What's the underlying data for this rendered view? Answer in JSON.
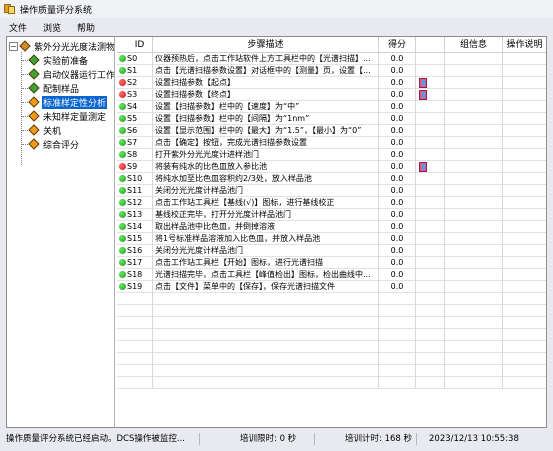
{
  "window": {
    "title": "操作质量评分系统"
  },
  "menu": [
    "文件",
    "浏览",
    "帮助"
  ],
  "tree": {
    "root_label": "紫外分光光度法测物质",
    "items": [
      {
        "label": "实验前准备",
        "icon": "green-diamond-icon",
        "selected": false
      },
      {
        "label": "启动仪器运行工作",
        "icon": "green-diamond-icon",
        "selected": false
      },
      {
        "label": "配制样品",
        "icon": "green-diamond-icon",
        "selected": false
      },
      {
        "label": "标准样定性分析",
        "icon": "orange-diamond-icon",
        "selected": true
      },
      {
        "label": "未知样定量测定",
        "icon": "orange-diamond-icon",
        "selected": false
      },
      {
        "label": "关机",
        "icon": "orange-diamond-icon",
        "selected": false
      },
      {
        "label": "综合评分",
        "icon": "orange-diamond-icon",
        "selected": false
      }
    ]
  },
  "grid": {
    "headers": [
      "ID",
      "步骤描述",
      "得分",
      "",
      "组信息",
      "操作说明"
    ],
    "rows": [
      {
        "status": "green",
        "id": "S0",
        "desc": "仪器预热后，点击工作站软件上方工具栏中的【光谱扫描】...",
        "score": "0.0"
      },
      {
        "status": "green",
        "id": "S1",
        "desc": "点击【光谱扫描参数设置】对话框中的【测量】页，设置【...",
        "score": "0.0"
      },
      {
        "status": "red",
        "id": "S2",
        "desc": "设置扫描参数【起点】",
        "score": "0.0"
      },
      {
        "status": "red",
        "id": "S3",
        "desc": "设置扫描参数【终点】",
        "score": "0.0"
      },
      {
        "status": "green",
        "id": "S4",
        "desc": "设置【扫描参数】栏中的【速度】为“中”",
        "score": "0.0"
      },
      {
        "status": "green",
        "id": "S5",
        "desc": "设置【扫描参数】栏中的【间隔】为“1nm”",
        "score": "0.0"
      },
      {
        "status": "green",
        "id": "S6",
        "desc": "设置【显示范围】栏中的【最大】为“1.5”，【最小】为“0”",
        "score": "0.0"
      },
      {
        "status": "green",
        "id": "S7",
        "desc": "点击【确定】按钮，完成光谱扫描参数设置",
        "score": "0.0"
      },
      {
        "status": "green",
        "id": "S8",
        "desc": "打开紫外分光光度计进样池门",
        "score": "0.0"
      },
      {
        "status": "red",
        "id": "S9",
        "desc": "将装有纯水的比色皿放入参比池",
        "score": "0.0"
      },
      {
        "status": "green",
        "id": "S10",
        "desc": "将纯水加至比色皿容积约2/3处，放入样品池",
        "score": "0.0"
      },
      {
        "status": "green",
        "id": "S11",
        "desc": "关闭分光光度计样品池门",
        "score": "0.0"
      },
      {
        "status": "green",
        "id": "S12",
        "desc": "点击工作站工具栏【基线(√)】图标，进行基线校正",
        "score": "0.0"
      },
      {
        "status": "green",
        "id": "S13",
        "desc": "基线校正完毕，打开分光度计样品池门",
        "score": "0.0"
      },
      {
        "status": "green",
        "id": "S14",
        "desc": "取出样品池中比色皿，并倒掉溶液",
        "score": "0.0"
      },
      {
        "status": "green",
        "id": "S15",
        "desc": "将1号标准样品溶液加入比色皿，并放入样品池",
        "score": "0.0"
      },
      {
        "status": "green",
        "id": "S16",
        "desc": "关闭分光光度计样品池门",
        "score": "0.0"
      },
      {
        "status": "green",
        "id": "S17",
        "desc": "点击工作站工具栏【开始】图标，进行光谱扫描",
        "score": "0.0"
      },
      {
        "status": "green",
        "id": "S18",
        "desc": "光谱扫描完毕，点击工具栏【峰值检出】图标，检出曲线中...",
        "score": "0.0"
      },
      {
        "status": "green",
        "id": "S19",
        "desc": "点击【文件】菜单中的【保存】，保存光谱扫描文件",
        "score": "0.0"
      }
    ]
  },
  "status": {
    "message": "操作质量评分系统已经启动。DCS操作被监控...",
    "elapsed": "培训限时: 0 秒",
    "training": "培训计时: 168 秒",
    "datetime": "2023/12/13 10:55:38"
  },
  "colors": {
    "status_green": "#15a015",
    "status_red": "#d01010",
    "selection": "#0a64d0"
  }
}
